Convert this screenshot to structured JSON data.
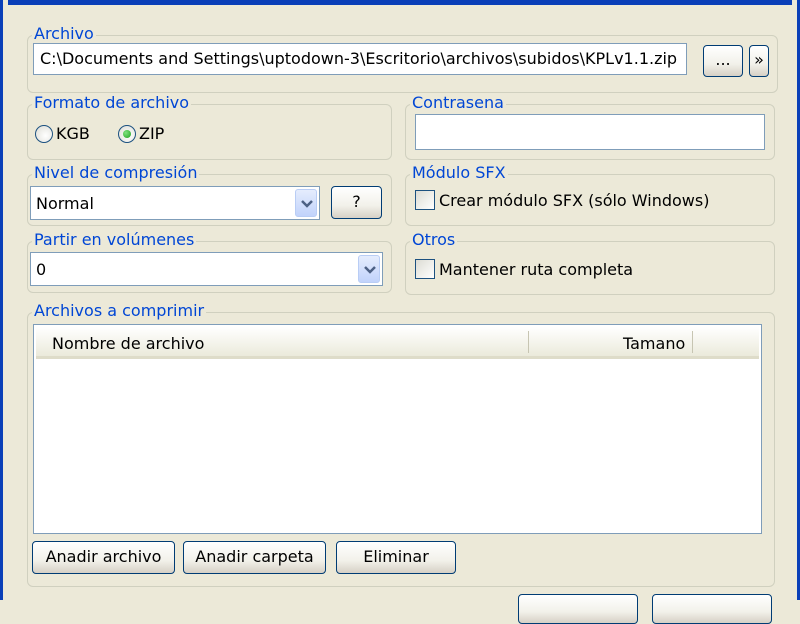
{
  "archivo": {
    "title": "Archivo",
    "path": "C:\\Documents and Settings\\uptodown-3\\Escritorio\\archivos\\subidos\\KPLv1.1.zip",
    "browse_label": "...",
    "more_label": "»"
  },
  "formato": {
    "title": "Formato de archivo",
    "options": [
      {
        "label": "KGB",
        "selected": false
      },
      {
        "label": "ZIP",
        "selected": true
      }
    ]
  },
  "contrasena": {
    "title": "Contrasena",
    "value": ""
  },
  "nivel": {
    "title": "Nivel de compresión",
    "selected": "Normal",
    "help_label": "?"
  },
  "sfx": {
    "title": "Módulo SFX",
    "checkbox_label": "Crear módulo SFX (sólo Windows)",
    "checked": false
  },
  "partir": {
    "title": "Partir en volúmenes",
    "selected": "0"
  },
  "otros": {
    "title": "Otros",
    "checkbox_label": "Mantener ruta completa",
    "checked": false
  },
  "archivos": {
    "title": "Archivos a comprimir",
    "columns": [
      "Nombre de archivo",
      "Tamano"
    ],
    "rows": [],
    "add_file_label": "Anadir archivo",
    "add_folder_label": "Anadir carpeta",
    "remove_label": "Eliminar"
  },
  "colors": {
    "window_bg": "#ece9d8",
    "group_title": "#0046d5",
    "title_bar": "#0a3fb8"
  }
}
